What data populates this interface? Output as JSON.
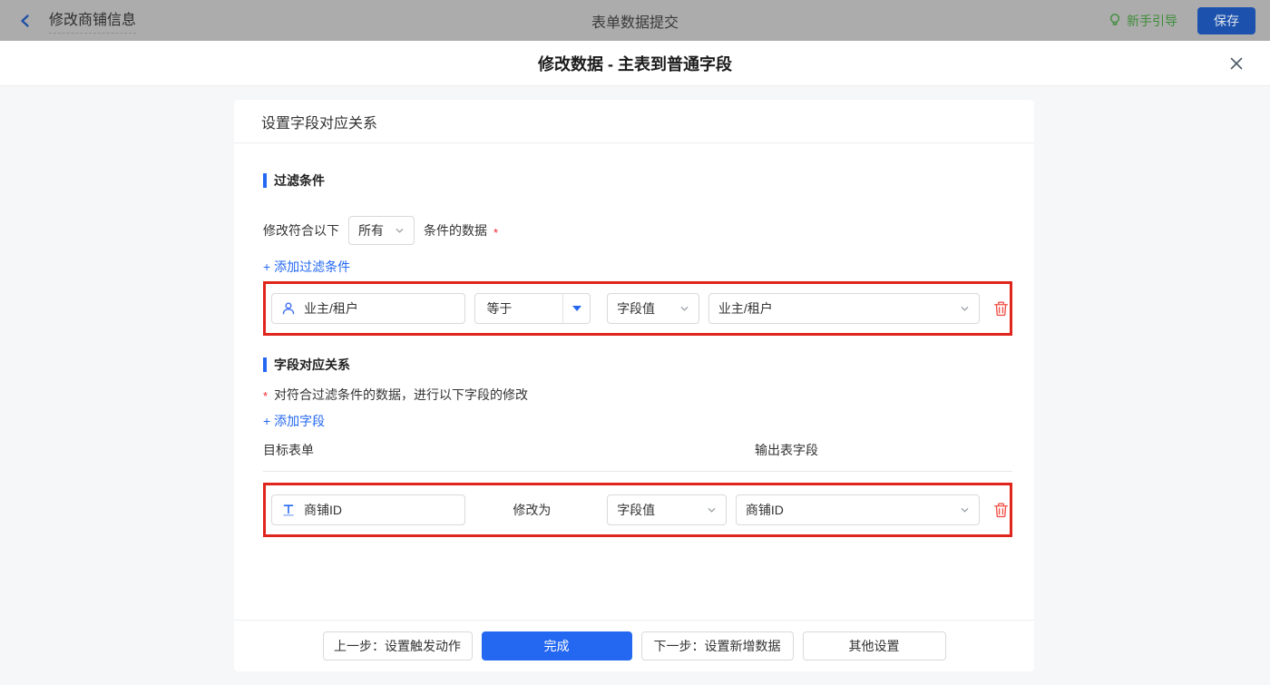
{
  "colors": {
    "accent_blue": "#2468f2",
    "highlight_red": "#e0251c",
    "trash_red": "#f15047",
    "guide_green": "#3f8d3a",
    "topbar_bg": "#acacac",
    "save_btn_bg": "#1c52ae"
  },
  "topbar": {
    "back_title": "修改商铺信息",
    "center_title": "表单数据提交",
    "guide_label": "新手引导",
    "save_label": "保存"
  },
  "modal": {
    "title": "修改数据 - 主表到普通字段"
  },
  "panel": {
    "header": "设置字段对应关系",
    "filter": {
      "title": "过滤条件",
      "match_prefix": "修改符合以下",
      "match_value": "所有",
      "match_suffix": "条件的数据",
      "required_mark": "*",
      "add_link": "+ 添加过滤条件",
      "row": {
        "field": "业主/租户",
        "operator": "等于",
        "value_type": "字段值",
        "value": "业主/租户"
      }
    },
    "mapping": {
      "title": "字段对应关系",
      "required_mark": "*",
      "description": "对符合过滤条件的数据，进行以下字段的修改",
      "add_link": "+ 添加字段",
      "columns": {
        "target": "目标表单",
        "output": "输出表字段"
      },
      "row": {
        "field": "商铺ID",
        "action": "修改为",
        "value_type": "字段值",
        "value": "商铺ID"
      }
    },
    "footer": {
      "prev": "上一步：设置触发动作",
      "done": "完成",
      "next": "下一步：设置新增数据",
      "other": "其他设置"
    }
  }
}
